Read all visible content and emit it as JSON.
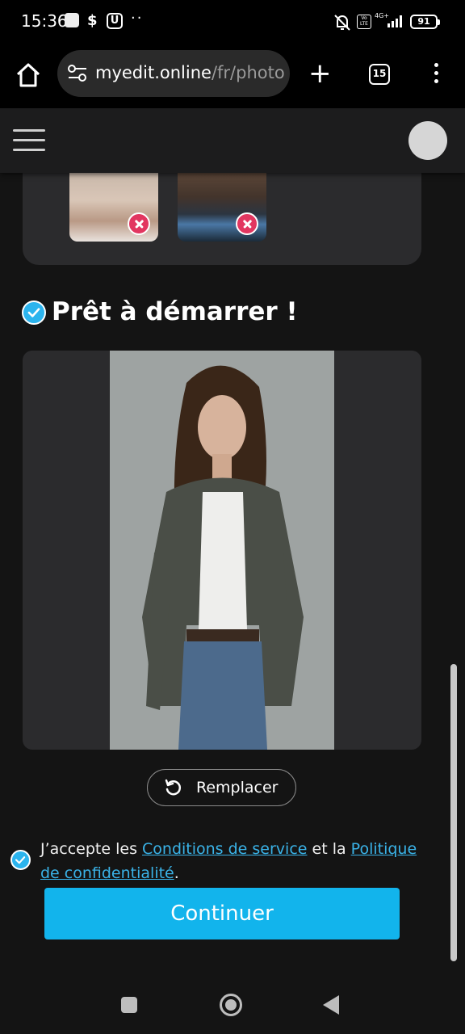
{
  "status_bar": {
    "time": "15:36",
    "dollar_icon": "$",
    "u_icon": "U",
    "more": "··",
    "volte": "Vo LTE",
    "network": "4G+",
    "battery": "91"
  },
  "browser": {
    "url_host": "myedit.online",
    "url_path": "/fr/photo",
    "tabs_count": "15",
    "icons": [
      "home-icon",
      "tune-icon",
      "plus-icon",
      "tabs-icon",
      "more-vert-icon"
    ]
  },
  "site_header": {
    "icons": [
      "hamburger-icon",
      "avatar"
    ]
  },
  "samples": {
    "icons": [
      "remove-icon"
    ]
  },
  "ready": {
    "title": "Prêt à démarrer !"
  },
  "replace_button": {
    "label": "Remplacer"
  },
  "terms": {
    "prefix": "J’accepte les ",
    "link1": "Conditions de service",
    "middle": " et la ",
    "link2": "Politique de confidentialité",
    "suffix": "."
  },
  "continue_button": {
    "label": "Continuer"
  },
  "colors": {
    "accent": "#12b4ec",
    "link": "#3ab3e8",
    "remove_badge": "#e23660",
    "card": "#2b2b2d",
    "background": "#141414"
  }
}
